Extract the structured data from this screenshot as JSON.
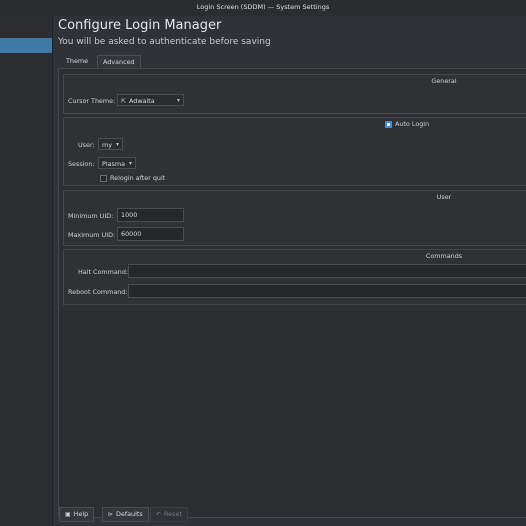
{
  "window": {
    "title": "Login Screen (SDDM) — System Settings"
  },
  "header": {
    "title": "Configure Login Manager",
    "subtitle": "You will be asked to authenticate before saving"
  },
  "tabs": [
    {
      "label": "Theme"
    },
    {
      "label": "Advanced"
    }
  ],
  "general": {
    "title": "General",
    "cursor_theme_label": "Cursor Theme:",
    "cursor_theme_value": "Adwaita"
  },
  "autologin": {
    "label": "Auto Login",
    "checked": true,
    "user_label": "User:",
    "user_value": "my",
    "session_label": "Session:",
    "session_value": "Plasma",
    "relogin_label": "Relogin after quit",
    "relogin_checked": false
  },
  "user": {
    "title": "User",
    "min_uid_label": "Minimum UID:",
    "min_uid_value": "1000",
    "max_uid_label": "Maximum UID:",
    "max_uid_value": "60000"
  },
  "commands": {
    "title": "Commands",
    "halt_label": "Halt Command:",
    "halt_value": "",
    "reboot_label": "Reboot Command:",
    "reboot_value": ""
  },
  "buttons": {
    "help": "Help",
    "defaults": "Defaults",
    "reset": "Reset"
  },
  "icons": {
    "help": "help-icon",
    "defaults": "defaults-icon",
    "reset": "reset-icon",
    "cursor": "cursor-icon"
  }
}
